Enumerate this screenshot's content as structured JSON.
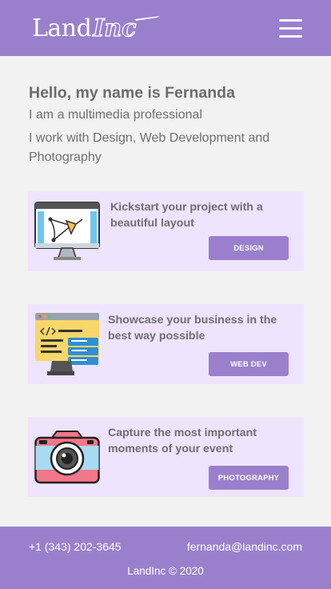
{
  "header": {
    "logo_primary": "Land",
    "logo_secondary": "Inc",
    "menu_icon": "hamburger-menu-icon"
  },
  "intro": {
    "greeting": "Hello, my name is Fernanda",
    "subtitle": "I am a multimedia professional",
    "description": "I work with Design, Web Development and Photography"
  },
  "cards": [
    {
      "icon": "design-monitor-icon",
      "text": "Kickstart your project with a beautiful layout",
      "button": "DESIGN"
    },
    {
      "icon": "web-code-screen-icon",
      "text": "Showcase your business in the best way possible",
      "button": "WEB DEV"
    },
    {
      "icon": "camera-icon",
      "text": "Capture the most important moments of your event",
      "button": "PHOTOGRAPHY"
    }
  ],
  "footer": {
    "phone": "+1 (343) 202-3645",
    "email": "fernanda@landinc.com",
    "copyright": "LandInc © 2020"
  },
  "colors": {
    "accent": "#9a80cc",
    "card_background": "#efe4fd",
    "page_background": "#f2f2f2",
    "text": "#6e6e6e"
  }
}
